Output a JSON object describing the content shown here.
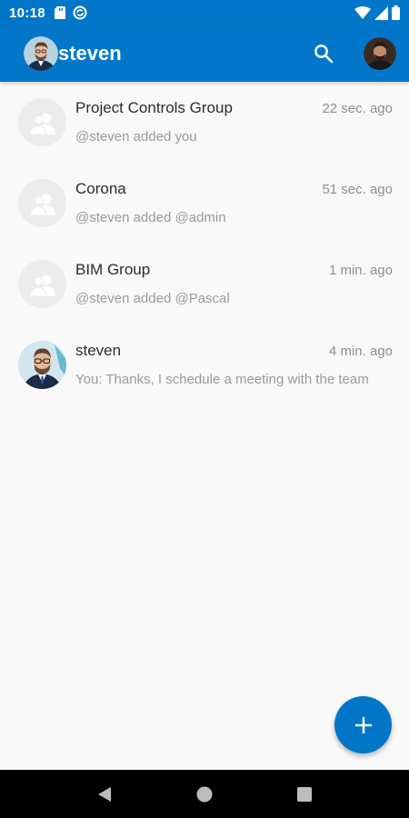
{
  "status_bar": {
    "time": "10:18",
    "left_icons": [
      "sd-card-icon",
      "sync-icon"
    ],
    "right_icons": [
      "wifi-icon",
      "signal-icon",
      "battery-icon"
    ]
  },
  "app_bar": {
    "title": "steven",
    "background_color": "#0277c9",
    "actions": [
      "search-icon",
      "profile-avatar"
    ]
  },
  "conversations": [
    {
      "name": "Project Controls Group",
      "time": "22 sec. ago",
      "preview": "@steven added you",
      "avatar": "group-placeholder-icon"
    },
    {
      "name": "Corona",
      "time": "51 sec. ago",
      "preview": "@steven added @admin",
      "avatar": "group-placeholder-icon"
    },
    {
      "name": "BIM Group",
      "time": "1 min. ago",
      "preview": "@steven added @Pascal",
      "avatar": "group-placeholder-icon"
    },
    {
      "name": "steven",
      "time": "4 min. ago",
      "preview": "You: Thanks, I schedule a meeting with the team",
      "avatar": "user-photo"
    }
  ],
  "fab": {
    "icon": "plus-icon"
  },
  "nav_bar": {
    "buttons": [
      "back-icon",
      "home-icon",
      "recents-icon"
    ]
  }
}
